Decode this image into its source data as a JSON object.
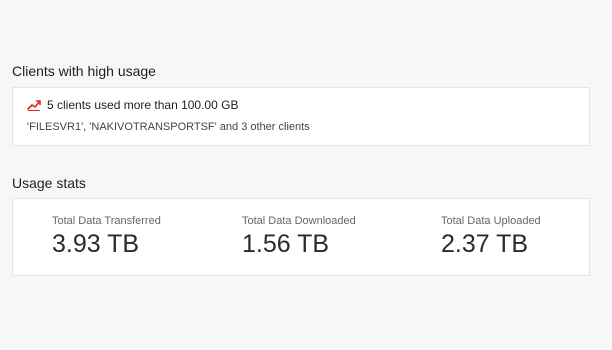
{
  "high_usage": {
    "title": "Clients with high usage",
    "alert_text": "5 clients used more than 100.00 GB",
    "clients_text": "'FILESVR1', 'NAKIVOTRANSPORTSF' and 3 other clients",
    "icon": "trending-up-icon",
    "alert_color": "#e02424"
  },
  "usage_stats": {
    "title": "Usage stats",
    "stats": [
      {
        "label": "Total Data Transferred",
        "value": "3.93 TB"
      },
      {
        "label": "Total Data Downloaded",
        "value": "1.56 TB"
      },
      {
        "label": "Total Data Uploaded",
        "value": "2.37 TB"
      }
    ]
  }
}
